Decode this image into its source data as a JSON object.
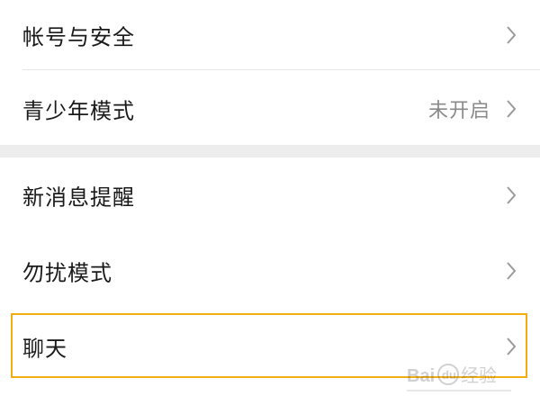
{
  "settings": {
    "group1": [
      {
        "label": "帐号与安全",
        "value": ""
      },
      {
        "label": "青少年模式",
        "value": "未开启"
      }
    ],
    "group2": [
      {
        "label": "新消息提醒",
        "value": ""
      },
      {
        "label": "勿扰模式",
        "value": ""
      },
      {
        "label": "聊天",
        "value": ""
      }
    ]
  },
  "highlight_color": "#f2ad12",
  "icons": {
    "row_chevron": "chevron-right-icon",
    "watermark": "baidu-jingyan-watermark"
  },
  "watermark_text": "Bai du 经验"
}
